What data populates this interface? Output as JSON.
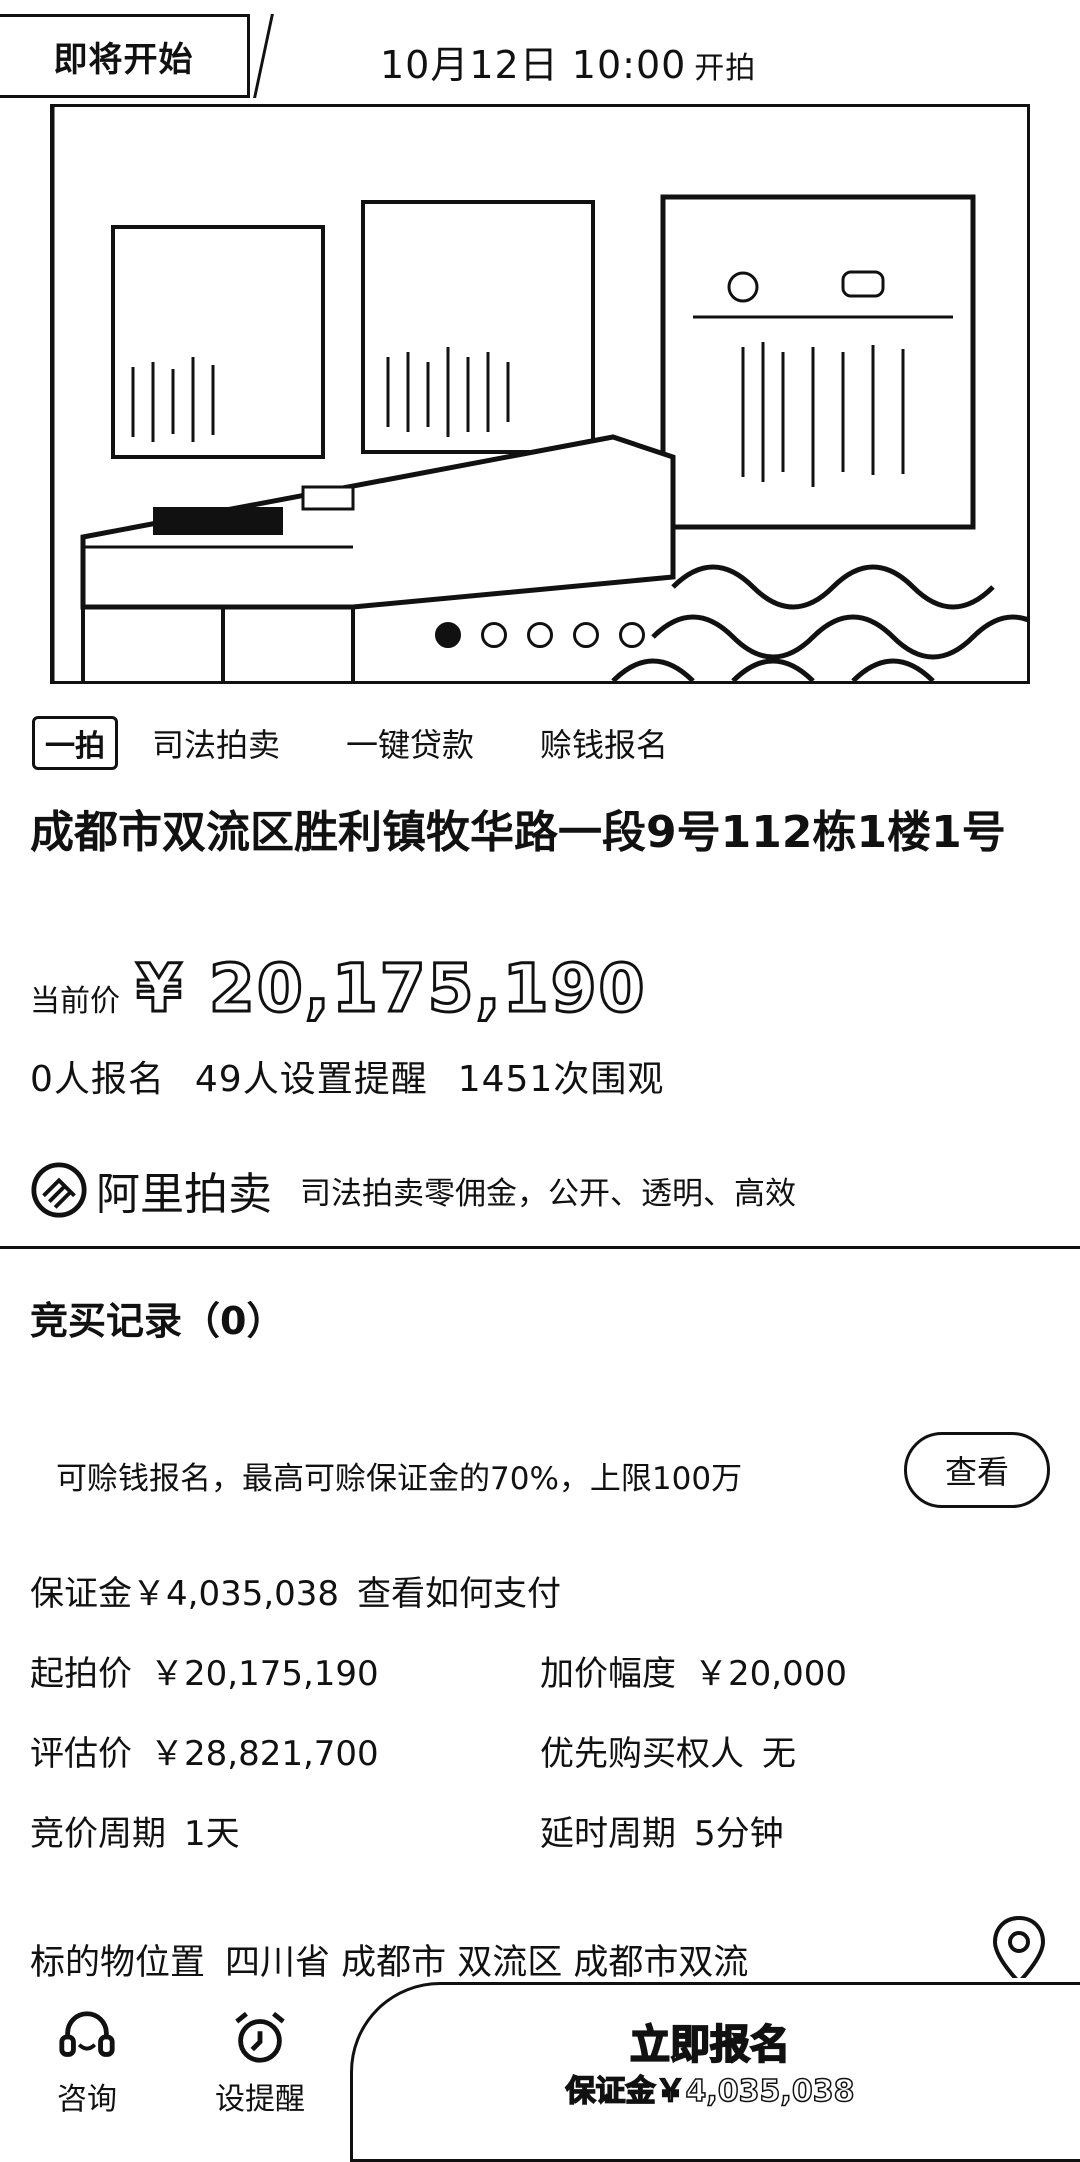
{
  "status": {
    "badge": "即将开始",
    "start_time": "10月12日 10:00",
    "start_suffix": "开拍"
  },
  "carousel": {
    "count": 5,
    "active_index": 0
  },
  "tags": {
    "boxed": "一拍",
    "items": [
      "司法拍卖",
      "一键贷款",
      "赊钱报名"
    ]
  },
  "title": "成都市双流区胜利镇牧华路一段9号112栋1楼1号",
  "price": {
    "label": "当前价",
    "value": "¥ 20,175,190"
  },
  "stats": [
    "0人报名",
    "49人设置提醒",
    "1451次围观"
  ],
  "brand": {
    "name": "阿里拍卖",
    "desc": "司法拍卖零佣金，公开、透明、高效"
  },
  "bids": {
    "title": "竞买记录（0）"
  },
  "loan": {
    "text": "可赊钱报名，最高可赊保证金的70%，上限100万",
    "button": "查看"
  },
  "deposit": {
    "text": "保证金￥4,035,038",
    "link": "查看如何支付"
  },
  "info": {
    "start_price": {
      "label": "起拍价",
      "value": "￥20,175,190"
    },
    "increment": {
      "label": "加价幅度",
      "value": "￥20,000"
    },
    "appraisal": {
      "label": "评估价",
      "value": "￥28,821,700"
    },
    "priority": {
      "label": "优先购买权人",
      "value": "无"
    },
    "period": {
      "label": "竞价周期",
      "value": "1天"
    },
    "delay": {
      "label": "延时周期",
      "value": "5分钟"
    }
  },
  "location": {
    "label": "标的物位置",
    "value": "四川省 成都市 双流区 成都市双流"
  },
  "bottom": {
    "consult": "咨询",
    "remind": "设提醒",
    "signup": "立即报名",
    "signup_sub": "保证金￥4,035,038"
  }
}
